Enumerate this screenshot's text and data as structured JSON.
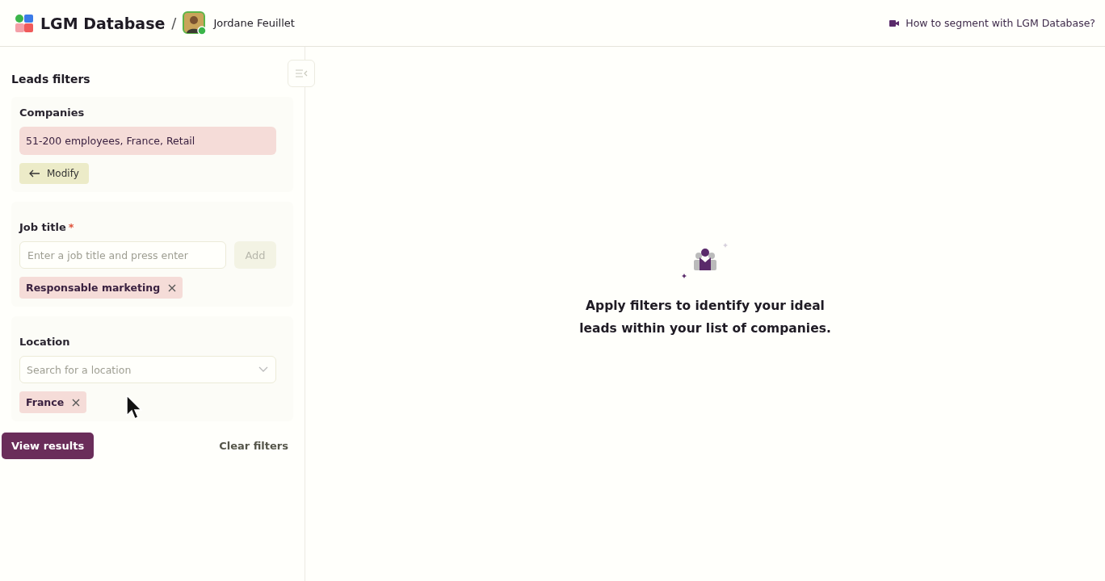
{
  "header": {
    "app_name": "LGM Database",
    "separator": "/",
    "user_name": "Jordane Feuillet",
    "help_link": "How to segment with LGM Database?"
  },
  "sidebar": {
    "title": "Leads filters",
    "companies": {
      "label": "Companies",
      "summary": "51-200 employees, France, Retail",
      "modify_button": "Modify"
    },
    "job_title": {
      "label": "Job title",
      "required": true,
      "required_mark": "*",
      "placeholder": "Enter a job title and press enter",
      "add_button": "Add",
      "tags": [
        "Responsable marketing"
      ]
    },
    "location": {
      "label": "Location",
      "placeholder": "Search for a location",
      "tags": [
        "France"
      ]
    },
    "view_results": "View results",
    "clear_filters": "Clear filters"
  },
  "empty_state": {
    "message": "Apply filters to identify your ideal leads within your list of companies."
  }
}
